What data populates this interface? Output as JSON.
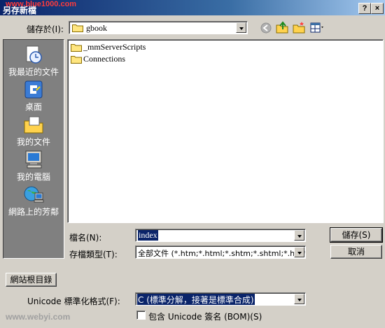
{
  "window": {
    "title": "另存新檔",
    "watermark_top": "www.blue1000.com",
    "help_button": "?",
    "close_button": "×"
  },
  "save_in": {
    "label": "儲存於(I):",
    "value": "gbook"
  },
  "places": [
    {
      "label": "我最近的文件",
      "icon": "recent-documents-icon"
    },
    {
      "label": "桌面",
      "icon": "desktop-icon"
    },
    {
      "label": "我的文件",
      "icon": "my-documents-icon"
    },
    {
      "label": "我的電腦",
      "icon": "my-computer-icon"
    },
    {
      "label": "網路上的芳鄰",
      "icon": "network-places-icon"
    }
  ],
  "files": [
    {
      "name": "_mmServerScripts",
      "icon": "folder-icon"
    },
    {
      "name": "Connections",
      "icon": "folder-icon"
    }
  ],
  "filename": {
    "label": "檔名(N):",
    "value": "index"
  },
  "filetype": {
    "label": "存檔類型(T):",
    "value": "全部文件 (*.htm;*.html;*.shtm;*.shtml;*.hts;*."
  },
  "buttons": {
    "save": "儲存(S)",
    "cancel": "取消",
    "site_root": "網站根目錄"
  },
  "unicode": {
    "label": "Unicode 標準化格式(F):",
    "value": "C (標準分解，接著是標準合成)"
  },
  "bom": {
    "label": "包含 Unicode 簽名 (BOM)(S)",
    "checked": false
  },
  "watermark_bottom": "www.webyi.com",
  "colors": {
    "title_start": "#0a246a",
    "face": "#d4d0c8",
    "places_bg": "#808080",
    "highlight": "#0a246a"
  }
}
